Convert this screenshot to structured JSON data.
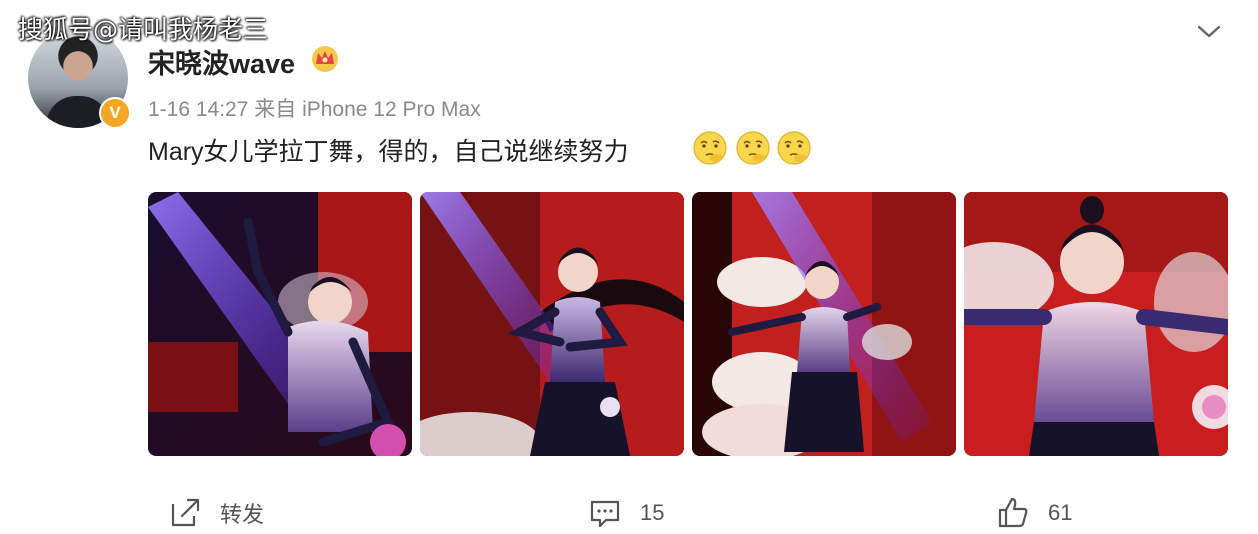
{
  "watermark": "搜狐号@请叫我杨老三",
  "post": {
    "username": "宋晓波wave",
    "meta": "1-16 14:27 来自 iPhone 12 Pro Max",
    "text": "Mary女儿学拉丁舞，得的，自己说继续努力",
    "emojis": [
      "thinking-emoji",
      "thinking-emoji",
      "thinking-emoji"
    ],
    "verified_badge": "V"
  },
  "actions": {
    "repost_label": "转发",
    "comment_count": "15",
    "like_count": "61"
  },
  "colors": {
    "badge": "#f5a623",
    "stage_red": "#c81e1e",
    "spotlight": "#7b4bff"
  }
}
